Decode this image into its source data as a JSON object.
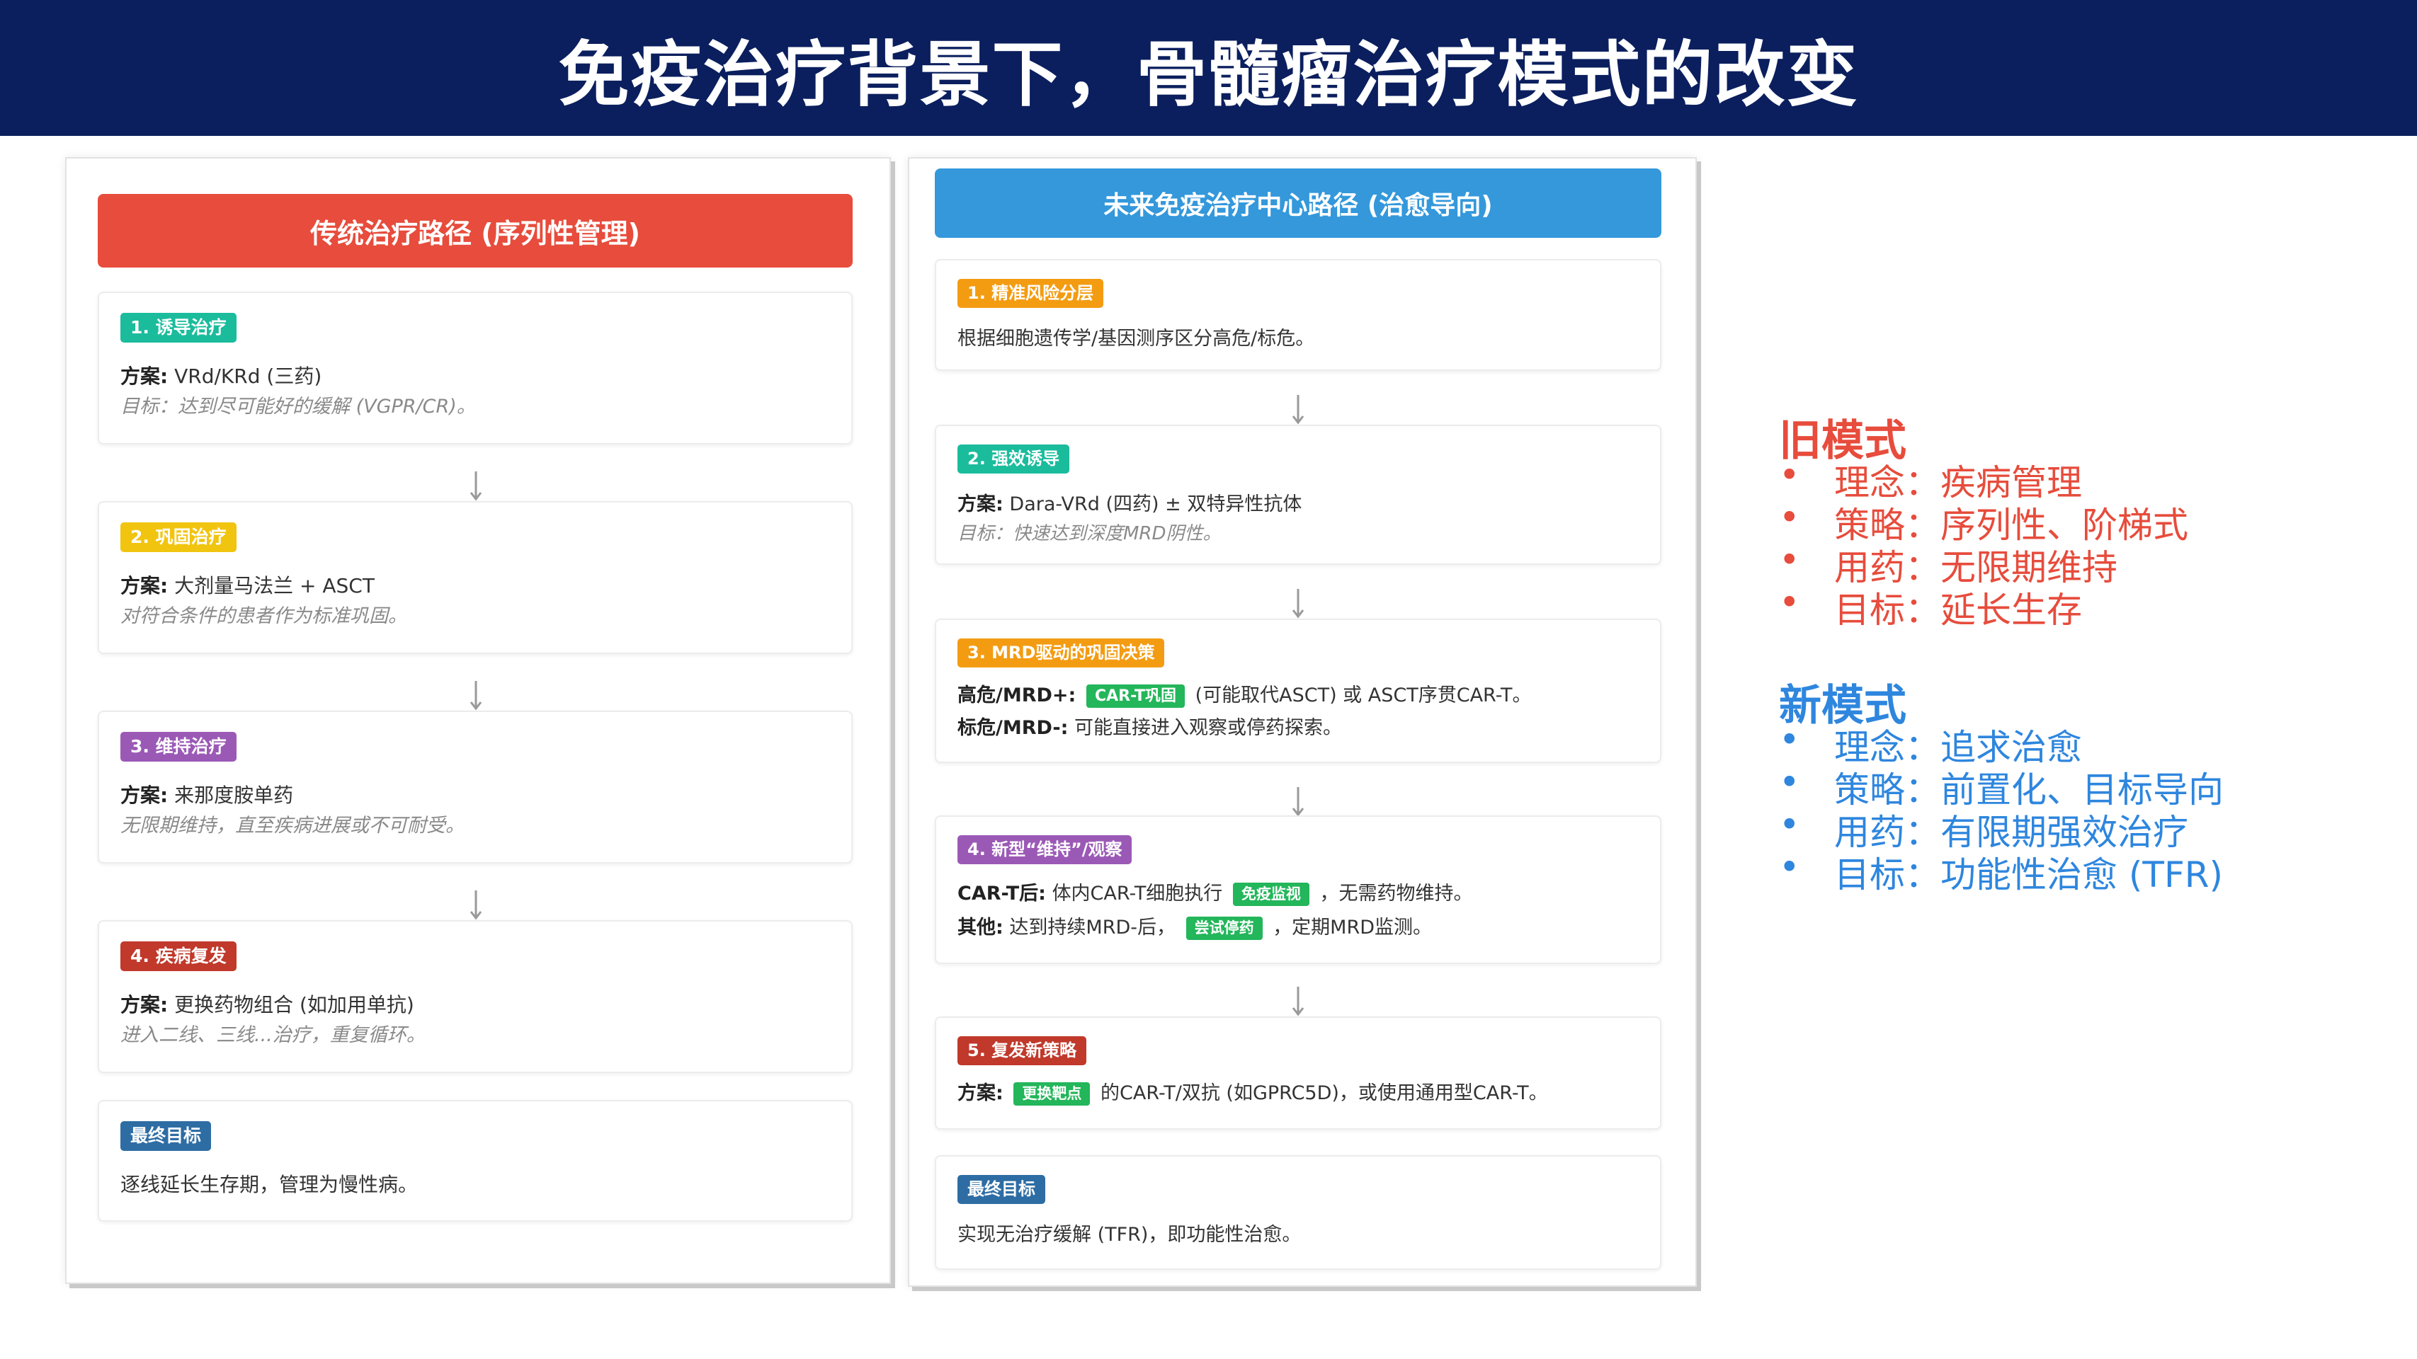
{
  "slide_title": "免疫治疗背景下，骨髓瘤治疗模式的改变",
  "colors": {
    "title_bar": "#0b1f5e",
    "left_header": "#e74c3c",
    "right_header": "#3498db",
    "old_mode": "#e74c3c",
    "new_mode": "#2e86de",
    "tag_green": "#23b65a"
  },
  "left_panel": {
    "header": "传统治疗路径 (序列性管理)",
    "steps": [
      {
        "badge": "1. 诱导治疗",
        "badge_color": "#1abc9c",
        "plan_label": "方案:",
        "plan_text": "VRd/KRd (三药)",
        "note": "目标：达到尽可能好的缓解 (VGPR/CR)。"
      },
      {
        "badge": "2. 巩固治疗",
        "badge_color": "#f1c40f",
        "plan_label": "方案:",
        "plan_text": "大剂量马法兰 + ASCT",
        "note": "对符合条件的患者作为标准巩固。"
      },
      {
        "badge": "3. 维持治疗",
        "badge_color": "#9b59b6",
        "plan_label": "方案:",
        "plan_text": "来那度胺单药",
        "note": "无限期维持，直至疾病进展或不可耐受。"
      },
      {
        "badge": "4. 疾病复发",
        "badge_color": "#c0392b",
        "plan_label": "方案:",
        "plan_text": "更换药物组合 (如加用单抗)",
        "note": "进入二线、三线...治疗，重复循环。"
      }
    ],
    "final": {
      "badge": "最终目标",
      "badge_color": "#2e6da4",
      "text": "逐线延长生存期，管理为慢性病。"
    }
  },
  "right_panel": {
    "header": "未来免疫治疗中心路径 (治愈导向)",
    "steps": [
      {
        "badge": "1. 精准风险分层",
        "badge_color": "#f39c12",
        "text": "根据细胞遗传学/基因测序区分高危/标危。"
      },
      {
        "badge": "2. 强效诱导",
        "badge_color": "#1abc9c",
        "plan_label": "方案:",
        "plan_text": "Dara-VRd (四药) ± 双特异性抗体",
        "note": "目标：快速达到深度MRD阴性。"
      },
      {
        "badge": "3. MRD驱动的巩固决策",
        "badge_color": "#f39c12",
        "line1_label": "高危/MRD+:",
        "line1_tag": "CAR-T巩固",
        "line1_text": "(可能取代ASCT) 或 ASCT序贯CAR-T。",
        "line2_label": "标危/MRD-:",
        "line2_text": "可能直接进入观察或停药探索。"
      },
      {
        "badge": "4. 新型“维持”/观察",
        "badge_color": "#9b59b6",
        "line1_label": "CAR-T后:",
        "line1_text_a": "体内CAR-T细胞执行",
        "line1_tag": "免疫监视",
        "line1_text_b": "，无需药物维持。",
        "line2_label": "其他:",
        "line2_text_a": "达到持续MRD-后，",
        "line2_tag": "尝试停药",
        "line2_text_b": "，定期MRD监测。"
      },
      {
        "badge": "5. 复发新策略",
        "badge_color": "#c0392b",
        "plan_label": "方案:",
        "plan_tag": "更换靶点",
        "plan_text": "的CAR-T/双抗 (如GPRC5D)，或使用通用型CAR-T。"
      }
    ],
    "final": {
      "badge": "最终目标",
      "badge_color": "#2e6da4",
      "text": "实现无治疗缓解 (TFR)，即功能性治愈。"
    }
  },
  "legend": {
    "old": {
      "title": "旧模式",
      "items": [
        "理念：疾病管理",
        "策略：序列性、阶梯式",
        "用药：无限期维持",
        "目标：延长生存"
      ]
    },
    "new": {
      "title": "新模式",
      "items": [
        "理念：追求治愈",
        "策略：前置化、目标导向",
        "用药：有限期强效治疗",
        "目标：功能性治愈 (TFR)"
      ]
    },
    "bullet": "•"
  }
}
